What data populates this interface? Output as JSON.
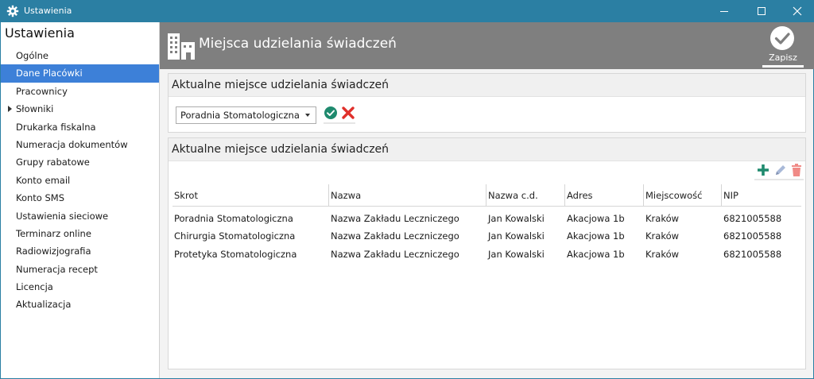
{
  "window": {
    "title": "Ustawienia"
  },
  "sidebar": {
    "heading": "Ustawienia",
    "items": [
      {
        "label": "Ogólne"
      },
      {
        "label": "Dane Placówki"
      },
      {
        "label": "Pracownicy"
      },
      {
        "label": "Słowniki"
      },
      {
        "label": "Drukarka fiskalna"
      },
      {
        "label": "Numeracja dokumentów"
      },
      {
        "label": "Grupy rabatowe"
      },
      {
        "label": "Konto email"
      },
      {
        "label": "Konto SMS"
      },
      {
        "label": "Ustawienia sieciowe"
      },
      {
        "label": "Terminarz online"
      },
      {
        "label": "Radiowizjografia"
      },
      {
        "label": "Numeracja recept"
      },
      {
        "label": "Licencja"
      },
      {
        "label": "Aktualizacja"
      }
    ]
  },
  "header": {
    "title": "Miejsca udzielania świadczeń",
    "save_label": "Zapisz"
  },
  "current_place": {
    "heading": "Aktualne miejsce udzielania świadczeń",
    "selected": "Poradnia Stomatologiczna"
  },
  "places_table": {
    "heading": "Aktualne miejsce udzielania świadczeń",
    "columns": [
      "Skrot",
      "Nazwa",
      "Nazwa c.d.",
      "Adres",
      "Miejscowość",
      "NIP"
    ],
    "rows": [
      [
        "Poradnia Stomatologiczna",
        "Nazwa Zakładu Leczniczego",
        "Jan Kowalski",
        "Akacjowa 1b",
        "Kraków",
        "6821005588"
      ],
      [
        "Chirurgia Stomatologiczna",
        "Nazwa Zakładu Leczniczego",
        "Jan Kowalski",
        "Akacjowa 1b",
        "Kraków",
        "6821005588"
      ],
      [
        "Protetyka Stomatologiczna",
        "Nazwa Zakładu Leczniczego",
        "Jan Kowalski",
        "Akacjowa 1b",
        "Kraków",
        "6821005588"
      ]
    ]
  },
  "colors": {
    "titlebar": "#2b7fa3",
    "active_item": "#3d80d8",
    "header_bg": "#7f7f7f",
    "ok_green": "#1f8a6e",
    "cancel_red": "#e0302b",
    "delete_pink": "#f08a86"
  }
}
